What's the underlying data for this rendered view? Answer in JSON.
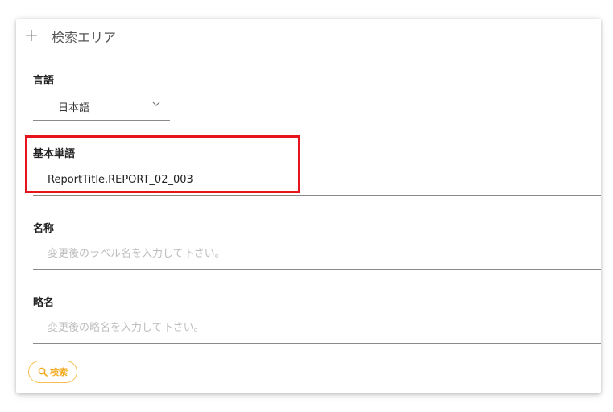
{
  "panel": {
    "title": "検索エリア",
    "header_icon": "plus-icon"
  },
  "language": {
    "label": "言語",
    "selected": "日本語",
    "icon": "chevron-down-icon"
  },
  "base_word": {
    "label": "基本単語",
    "value": "ReportTitle.REPORT_02_003"
  },
  "name": {
    "label": "名称",
    "placeholder": "変更後のラベル名を入力して下さい。"
  },
  "short_name": {
    "label": "略名",
    "placeholder": "変更後の略名を入力して下さい。"
  },
  "search_button": {
    "label": "検索",
    "icon": "search-icon",
    "color": "#f0a81c"
  },
  "colors": {
    "highlight": "#e8141c",
    "accent": "#f6bf53"
  }
}
